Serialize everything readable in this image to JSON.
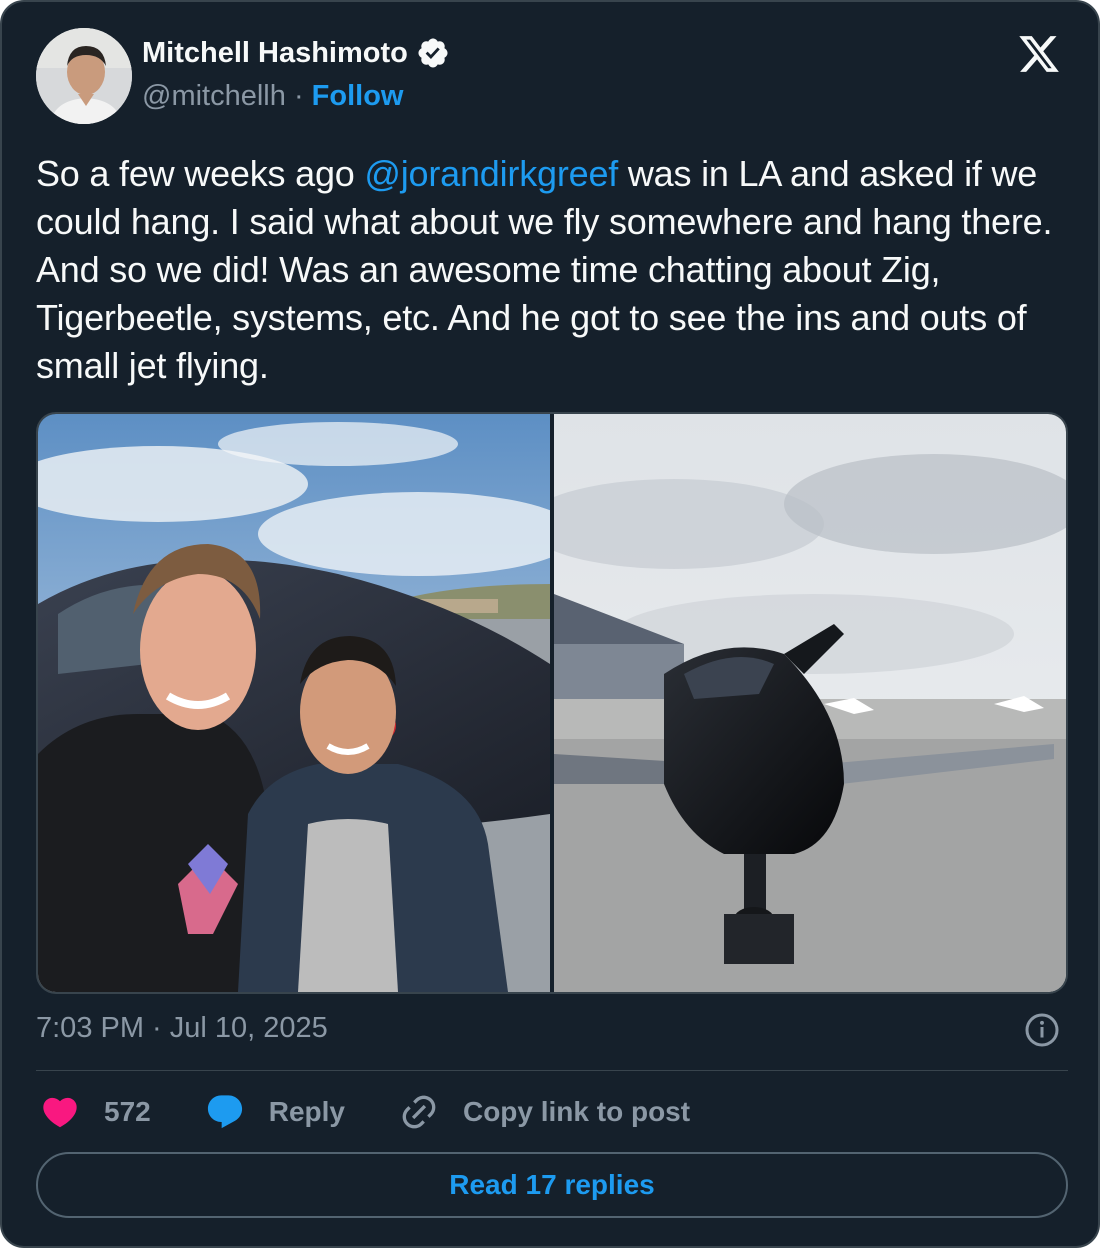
{
  "author": {
    "name": "Mitchell Hashimoto",
    "handle": "@mitchellh",
    "separator": "·",
    "follow_label": "Follow",
    "verified": true
  },
  "brand": {
    "icon": "x-logo-icon"
  },
  "tweet": {
    "text_before": "So a few weeks ago ",
    "mention": "@jorandirkgreef",
    "text_after": " was in LA and asked if we could hang. I said what about we fly somewhere and hang there. And so we did! Was an awesome time chatting about Zig, Tigerbeetle, systems, etc. And he got to see the ins and outs of small jet flying."
  },
  "media": {
    "photos": [
      "selfie-photo",
      "jet-photo"
    ]
  },
  "timestamp": "7:03 PM · Jul 10, 2025",
  "actions": {
    "like_count": "572",
    "reply_label": "Reply",
    "copy_label": "Copy link to post"
  },
  "read_replies_label": "Read 17 replies",
  "colors": {
    "background": "#15202b",
    "border": "#38444d",
    "text_primary": "#f7f9f9",
    "text_secondary": "#8b98a5",
    "accent": "#1d9bf0",
    "like": "#f91880"
  }
}
